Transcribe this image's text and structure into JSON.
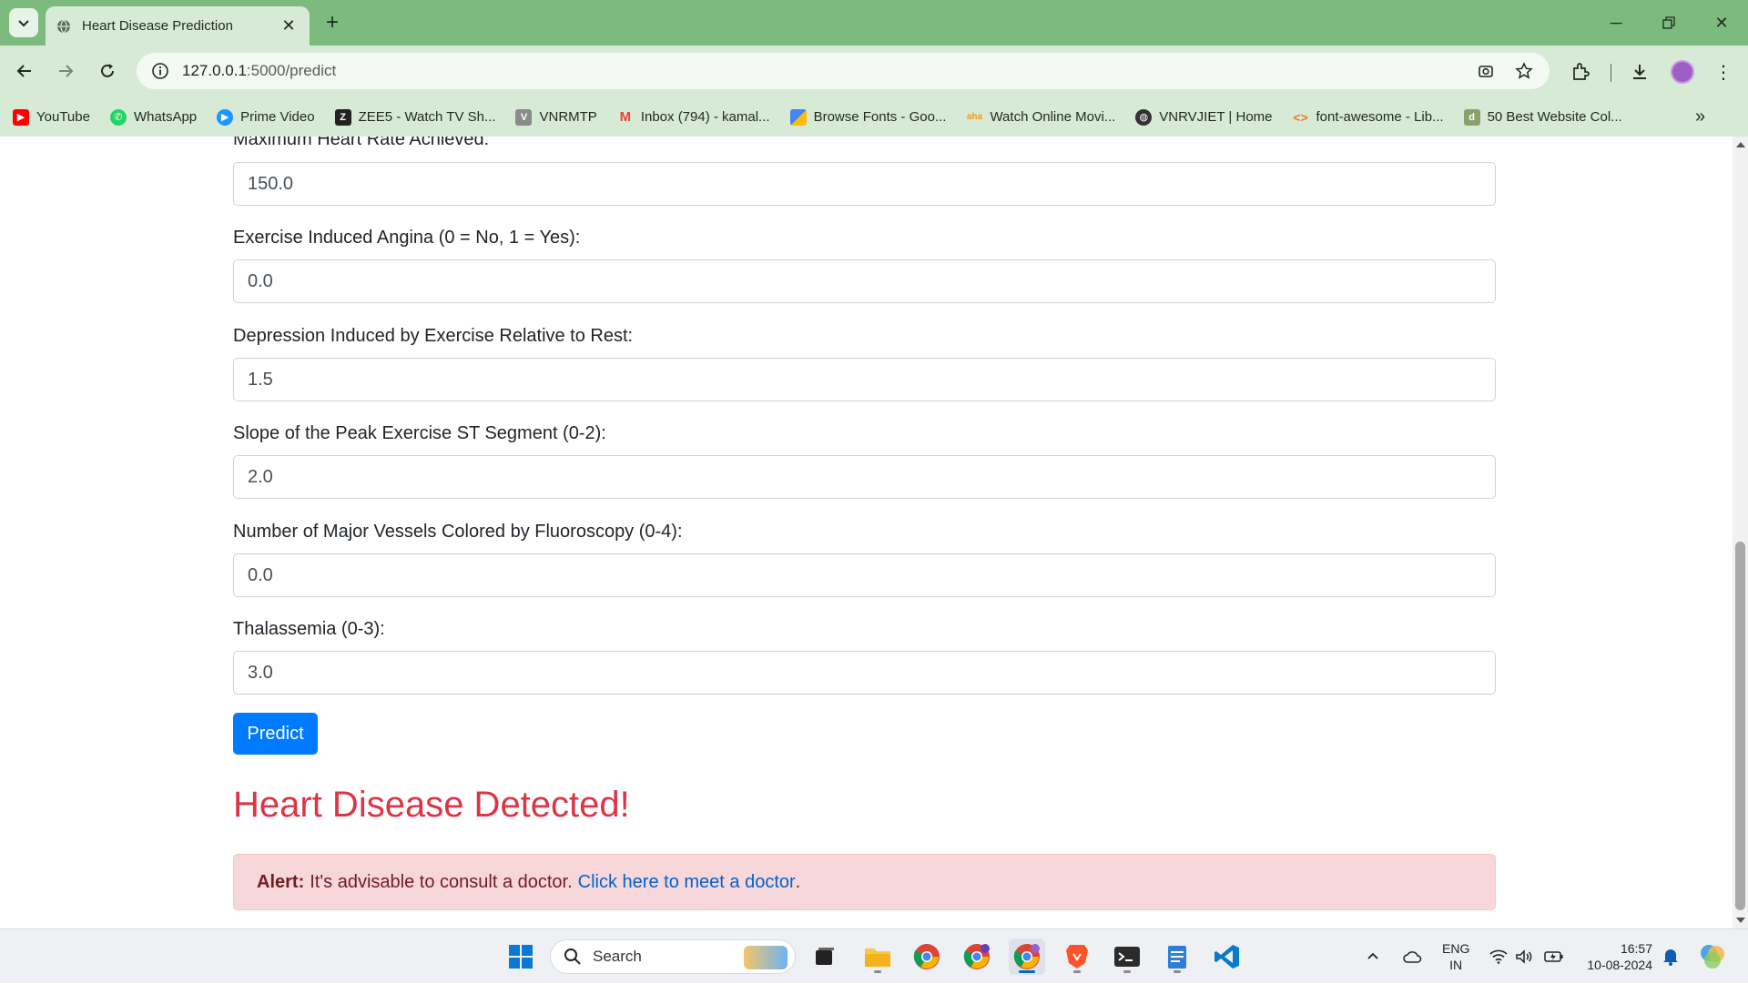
{
  "browser": {
    "tab_title": "Heart Disease Prediction",
    "url_host": "127.0.0.1",
    "url_path": ":5000/predict",
    "bookmarks": [
      {
        "label": "YouTube",
        "color": "#ff0000"
      },
      {
        "label": "WhatsApp",
        "color": "#25d366"
      },
      {
        "label": "Prime Video",
        "color": "#1a98ff"
      },
      {
        "label": "ZEE5 - Watch TV Sh...",
        "color": "#222222"
      },
      {
        "label": "VNRMTP",
        "color": "#8a8a8a"
      },
      {
        "label": "Inbox (794) - kamal...",
        "color": "#ea4335"
      },
      {
        "label": "Browse Fonts - Goo...",
        "color": "#4285f4"
      },
      {
        "label": "Watch Online Movi...",
        "color": "#f39c12"
      },
      {
        "label": "VNRVJIET | Home",
        "color": "#333333"
      },
      {
        "label": "font-awesome - Lib...",
        "color": "#e67e22"
      },
      {
        "label": "50 Best Website Col...",
        "color": "#8aa06a"
      }
    ]
  },
  "form": {
    "fields": [
      {
        "label": "Maximum Heart Rate Achieved:",
        "value": "150.0"
      },
      {
        "label": "Exercise Induced Angina (0 = No, 1 = Yes):",
        "value": "0.0"
      },
      {
        "label": "Depression Induced by Exercise Relative to Rest:",
        "value": "1.5"
      },
      {
        "label": "Slope of the Peak Exercise ST Segment (0-2):",
        "value": "2.0"
      },
      {
        "label": "Number of Major Vessels Colored by Fluoroscopy (0-4):",
        "value": "0.0"
      },
      {
        "label": "Thalassemia (0-3):",
        "value": "3.0"
      }
    ],
    "submit_label": "Predict"
  },
  "result": {
    "heading": "Heart Disease Detected!",
    "alert_strong": "Alert:",
    "alert_text": "It's advisable to consult a doctor.",
    "alert_link": "Click here to meet a doctor",
    "alert_end": "."
  },
  "taskbar": {
    "search_placeholder": "Search",
    "lang_line1": "ENG",
    "lang_line2": "IN",
    "time": "16:57",
    "date": "10-08-2024"
  },
  "colors": {
    "browser_frame": "#7cba7e",
    "primary_button": "#007bff",
    "danger_text": "#dc3545",
    "alert_bg": "#f8d7da"
  }
}
